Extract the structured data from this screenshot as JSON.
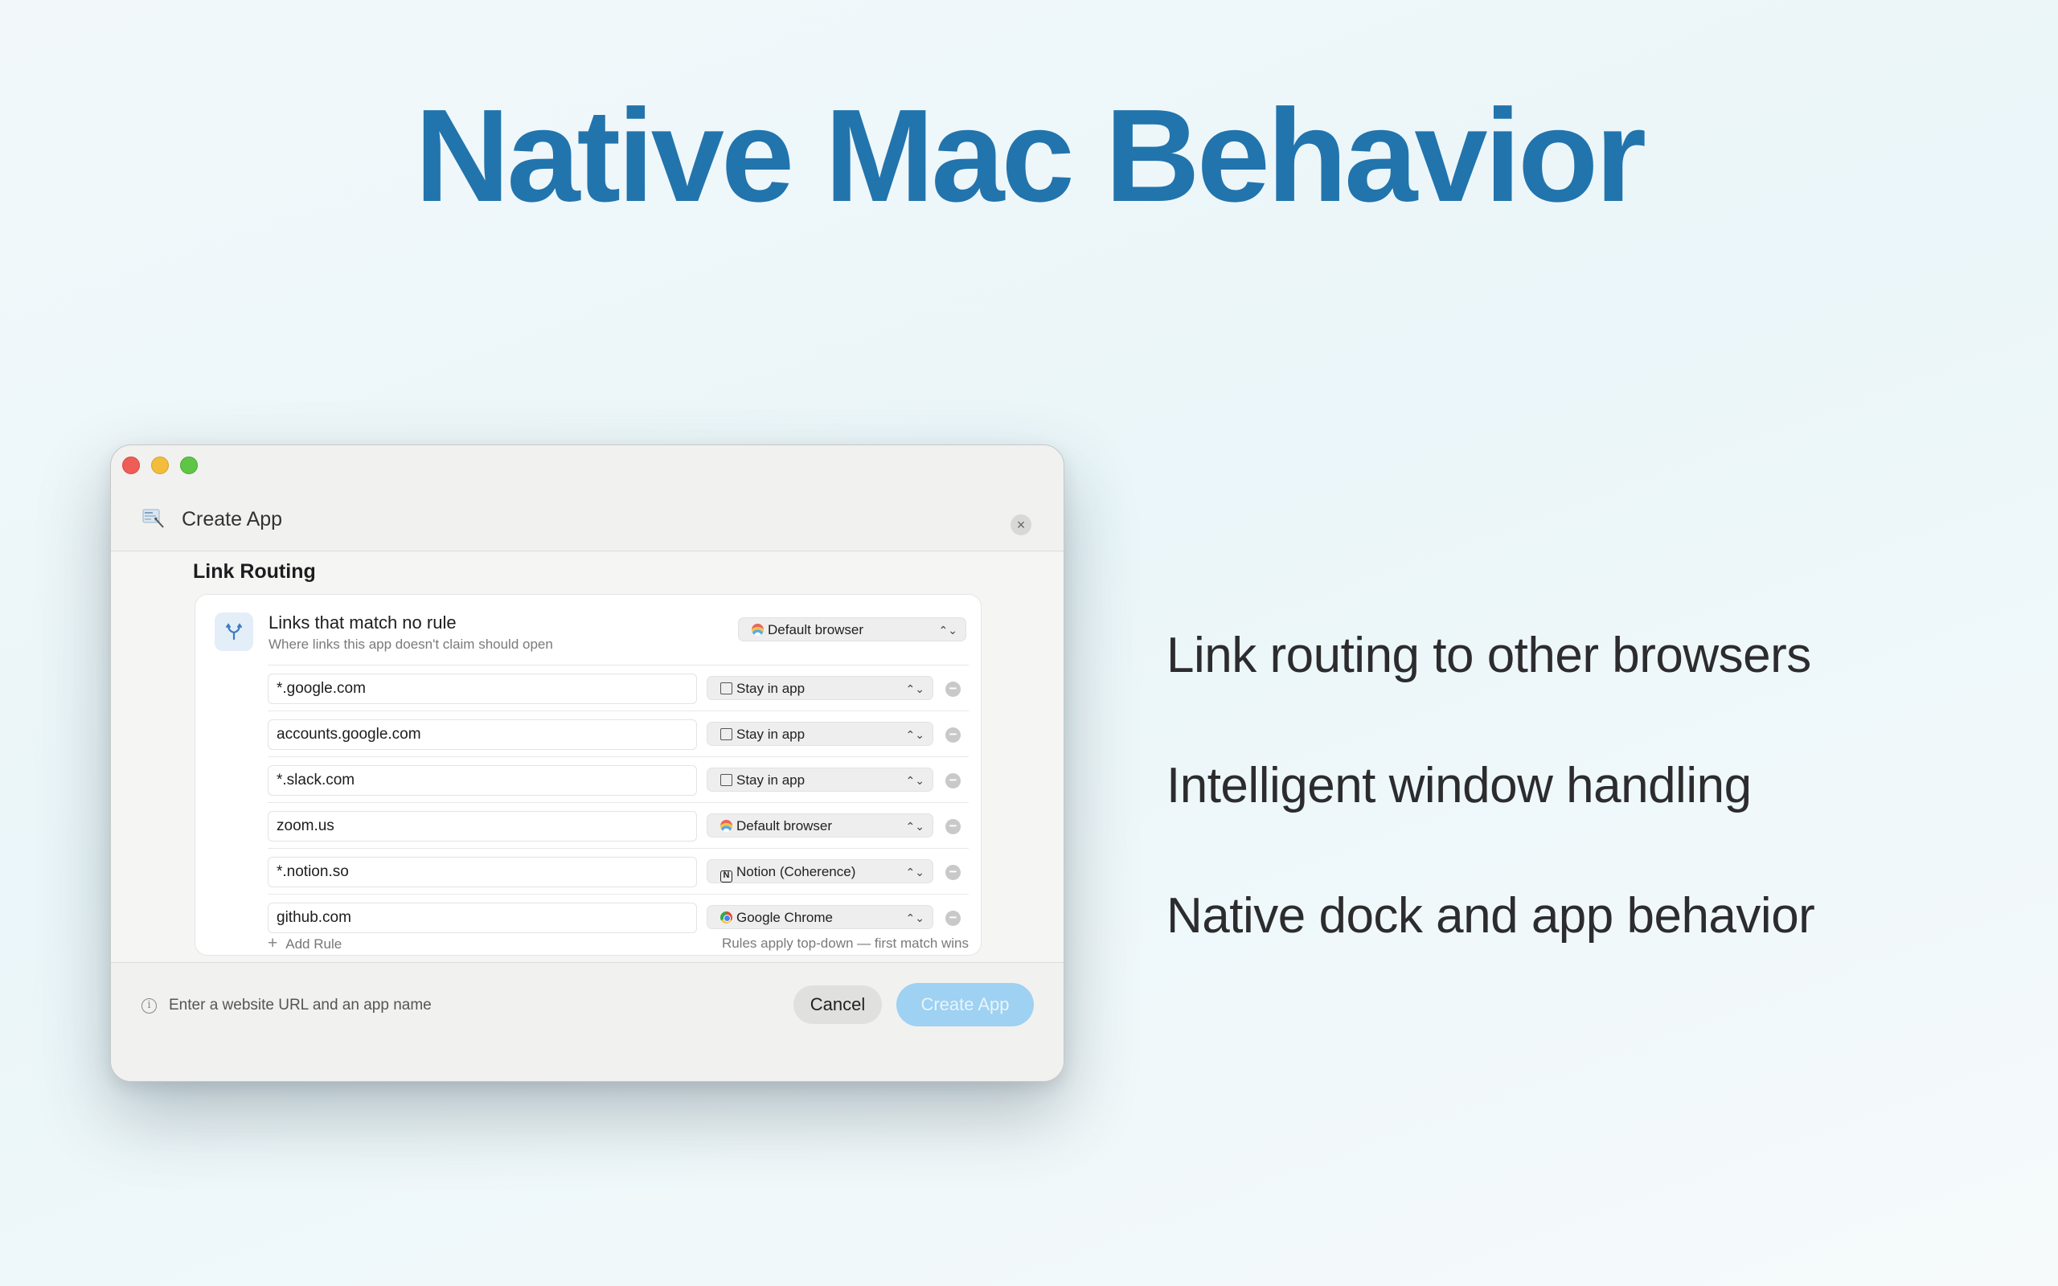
{
  "headline": "Native Mac Behavior",
  "features": [
    "Link routing to other browsers",
    "Intelligent window handling",
    "Native dock and app behavior"
  ],
  "window": {
    "title": "Create App",
    "section_title": "Link Routing",
    "default_rule": {
      "title": "Links that match no rule",
      "subtitle": "Where links this app doesn't claim should open",
      "target": "Default browser"
    },
    "rules": [
      {
        "pattern": "*.google.com",
        "target": "Stay in app",
        "icon": "stay-in-app-icon"
      },
      {
        "pattern": "accounts.google.com",
        "target": "Stay in app",
        "icon": "stay-in-app-icon"
      },
      {
        "pattern": "*.slack.com",
        "target": "Stay in app",
        "icon": "stay-in-app-icon"
      },
      {
        "pattern": "zoom.us",
        "target": "Default browser",
        "icon": "default-browser-icon"
      },
      {
        "pattern": "*.notion.so",
        "target": "Notion (Coherence)",
        "icon": "notion-icon"
      },
      {
        "pattern": "github.com",
        "target": "Google Chrome",
        "icon": "chrome-icon"
      }
    ],
    "add_rule_label": "Add Rule",
    "rules_hint": "Rules apply top-down — first match wins",
    "footer": {
      "info_text": "Enter a website URL and an app name",
      "cancel_label": "Cancel",
      "create_label": "Create App"
    }
  },
  "colors": {
    "headline": "#2274ad",
    "primary_button_disabled": "#9ed1f2",
    "close": "#ee5d57",
    "minimize": "#f2bd3b",
    "zoom": "#5fc546"
  }
}
